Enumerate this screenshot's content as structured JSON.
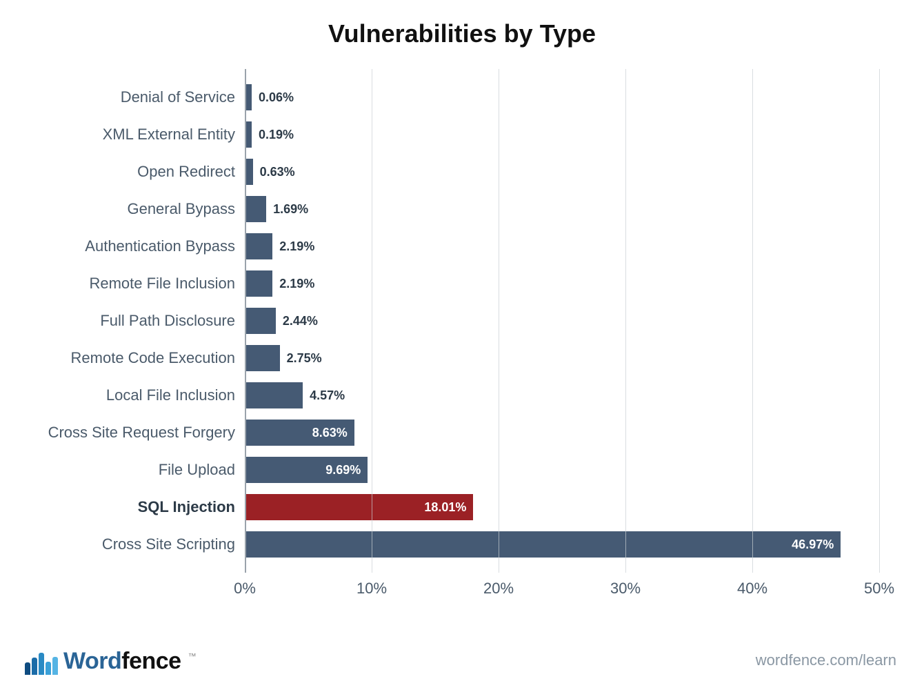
{
  "chart_data": {
    "type": "bar",
    "orientation": "horizontal",
    "title": "Vulnerabilities by Type",
    "xlabel": "",
    "ylabel": "",
    "xlim": [
      0,
      50
    ],
    "x_tick_step": 10,
    "x_tick_suffix": "%",
    "value_suffix": "%",
    "categories": [
      "Denial of Service",
      "XML External Entity",
      "Open Redirect",
      "General Bypass",
      "Authentication Bypass",
      "Remote File Inclusion",
      "Full Path Disclosure",
      "Remote Code Execution",
      "Local File Inclusion",
      "Cross Site Request Forgery",
      "File Upload",
      "SQL Injection",
      "Cross Site Scripting"
    ],
    "values": [
      0.06,
      0.19,
      0.63,
      1.69,
      2.19,
      2.19,
      2.44,
      2.75,
      4.57,
      8.63,
      9.69,
      18.01,
      46.97
    ],
    "highlight_index": 11,
    "colors": {
      "default_bar": "#455a74",
      "highlight_bar": "#9b2125"
    },
    "label_inside_threshold": 7
  },
  "footer": {
    "brand_word_a": "Word",
    "brand_word_b": "fence",
    "link_text": "wordfence.com/learn",
    "logo_bar_colors": [
      "#0f4c81",
      "#1b6ca8",
      "#2a8ac4",
      "#3aa0d8",
      "#55b4e4"
    ]
  }
}
